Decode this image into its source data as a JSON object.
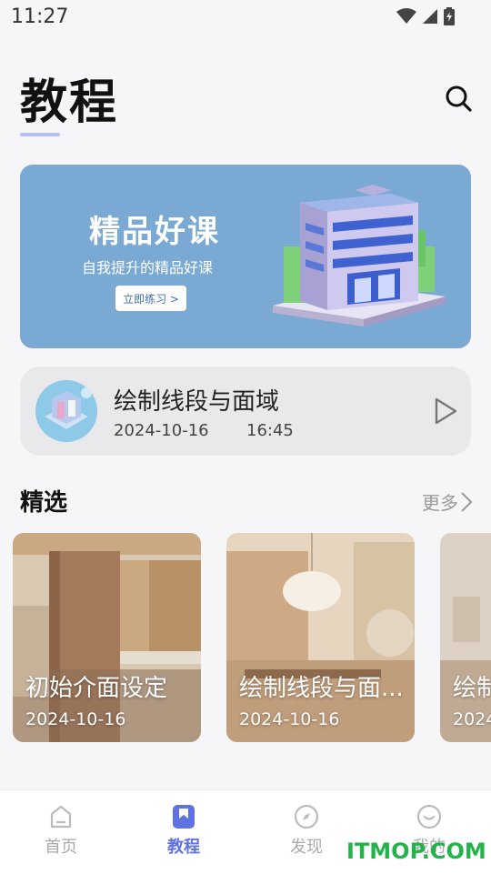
{
  "status_bar": {
    "time": "11:27"
  },
  "header": {
    "title": "教程"
  },
  "banner": {
    "title": "精品好课",
    "subtitle": "自我提升的精品好课",
    "button_label": "立即练习 >"
  },
  "recent": {
    "title": "绘制线段与面域",
    "date": "2024-10-16",
    "time": "16:45"
  },
  "featured": {
    "title": "精选",
    "more_label": "更多",
    "items": [
      {
        "title": "初始介面设定",
        "date": "2024-10-16"
      },
      {
        "title": "绘制线段与面...",
        "date": "2024-10-16"
      },
      {
        "title": "绘制",
        "date": "2024"
      }
    ]
  },
  "tabs": [
    {
      "label": "首页",
      "icon": "home-icon"
    },
    {
      "label": "教程",
      "icon": "bookmark-icon"
    },
    {
      "label": "发现",
      "icon": "compass-icon"
    },
    {
      "label": "我的",
      "icon": "profile-icon"
    }
  ],
  "colors": {
    "accent": "#5e72e4",
    "banner_bg": "#7aa9d4"
  },
  "watermark": "ITMOP.COM"
}
